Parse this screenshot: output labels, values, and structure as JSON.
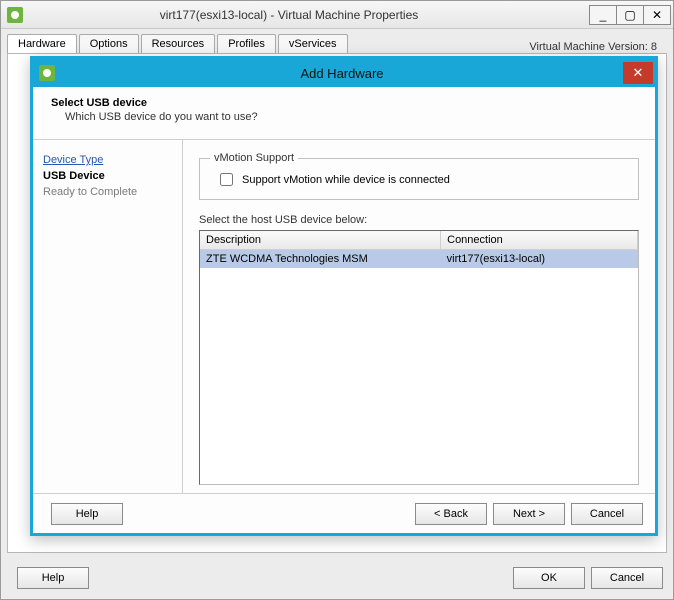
{
  "parent": {
    "title": "virt177(esxi13-local) - Virtual Machine Properties",
    "win_controls": {
      "minimize": "_",
      "maximize": "▢",
      "close": "✕"
    },
    "tabs": [
      {
        "label": "Hardware",
        "active": true
      },
      {
        "label": "Options"
      },
      {
        "label": "Resources"
      },
      {
        "label": "Profiles"
      },
      {
        "label": "vServices"
      }
    ],
    "vm_version": "Virtual Machine Version: 8",
    "footer": {
      "help": "Help",
      "ok": "OK",
      "cancel": "Cancel"
    }
  },
  "modal": {
    "title": "Add Hardware",
    "close_glyph": "✕",
    "header": {
      "title": "Select USB device",
      "subtitle": "Which USB device do you want to use?"
    },
    "nav": [
      {
        "label": "Device Type",
        "kind": "link"
      },
      {
        "label": "USB Device",
        "kind": "current"
      },
      {
        "label": "Ready to Complete",
        "kind": "future"
      }
    ],
    "vmotion": {
      "legend": "vMotion Support",
      "checkbox_label": "Support vMotion while device is connected",
      "checked": false
    },
    "usb_prompt": "Select the host USB device below:",
    "usb_columns": {
      "desc": "Description",
      "conn": "Connection"
    },
    "usb_rows": [
      {
        "desc": "ZTE WCDMA Technologies MSM",
        "conn": "virt177(esxi13-local)",
        "selected": true
      }
    ],
    "footer": {
      "help": "Help",
      "back": "< Back",
      "next": "Next >",
      "cancel": "Cancel"
    }
  },
  "colors": {
    "modal_border": "#18a7d6",
    "close_btn": "#c53b2b"
  }
}
